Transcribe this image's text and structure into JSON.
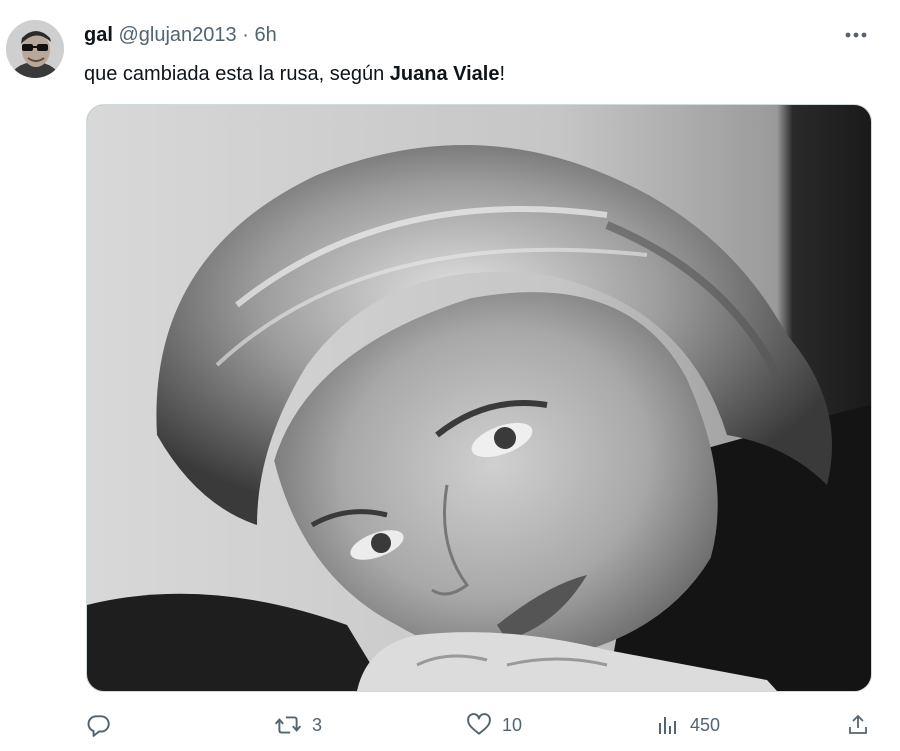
{
  "tweet": {
    "author": {
      "display_name": "gal",
      "handle": "@glujan2013",
      "separator": "·",
      "time": "6h"
    },
    "text": {
      "before": "que cambiada esta la rusa, según ",
      "bold": "Juana Viale",
      "after": "!"
    },
    "stats": {
      "replies": "",
      "retweets": "3",
      "likes": "10",
      "views": "450"
    }
  },
  "colors": {
    "text_primary": "#0f1419",
    "text_secondary": "#536471",
    "border": "#cfd9de"
  },
  "icons": [
    "more-icon",
    "reply-icon",
    "retweet-icon",
    "like-icon",
    "views-icon",
    "share-icon"
  ]
}
